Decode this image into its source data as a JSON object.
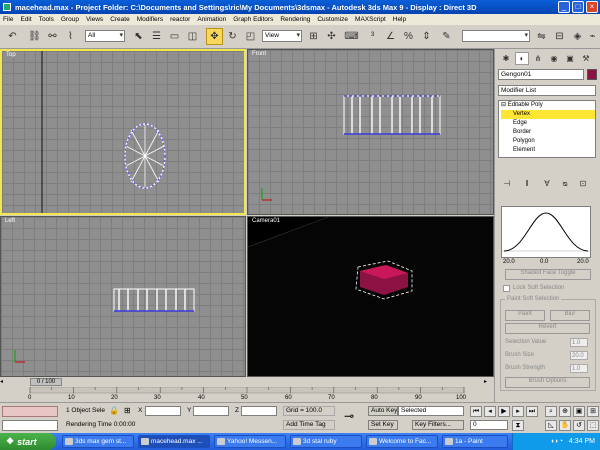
{
  "window": {
    "title": "macehead.max   - Project Folder: C:\\Documents and Settings\\ric\\My Documents\\3dsmax   - Autodesk 3ds Max 9   - Display : Direct 3D"
  },
  "menu": [
    "File",
    "Edit",
    "Tools",
    "Group",
    "Views",
    "Create",
    "Modifiers",
    "reactor",
    "Animation",
    "Graph Editors",
    "Rendering",
    "Customize",
    "MAXScript",
    "Help"
  ],
  "toolbar": {
    "selection_filter": "All",
    "coord_system": "View"
  },
  "viewports": {
    "top": "Top",
    "front": "Front",
    "left": "Left",
    "camera": "Camera01"
  },
  "command_panel": {
    "object_name": "Gengon01",
    "modifier_list": "Modifier List",
    "stack": [
      "Editable Poly",
      "Vertex",
      "Edge",
      "Border",
      "Polygon",
      "Element"
    ],
    "selected_subobject": "Vertex",
    "curve_labels": [
      "20.0",
      "0.0",
      "20.0"
    ],
    "shaded_face_toggle": "Shaded Face Toggle",
    "lock_soft_selection": "Lock Soft Selection",
    "paint_soft_selection": "Paint Soft Selection",
    "paint": "Paint",
    "blur": "Blur",
    "revert": "Revert",
    "selection_value_label": "Selection Value",
    "selection_value": "1.0",
    "brush_size_label": "Brush Size",
    "brush_size": "20.0",
    "brush_strength_label": "Brush Strength",
    "brush_strength": "1.0",
    "brush_options": "Brush Options"
  },
  "timeline": {
    "frame_display": "0 / 100",
    "ticks": [
      "0",
      "10",
      "20",
      "30",
      "40",
      "50",
      "60",
      "70",
      "80",
      "90",
      "100"
    ]
  },
  "status": {
    "selection_info": "1 Object Sele",
    "x_label": "X",
    "y_label": "Y",
    "z_label": "Z",
    "grid": "Grid = 100.0",
    "auto_key": "Auto Key",
    "key_mode": "Selected",
    "set_key": "Set Key",
    "key_filters": "Key Filters...",
    "rendering_time": "Rendering Time  0:00:00",
    "add_time_tag": "Add Time Tag",
    "current_frame": "0"
  },
  "taskbar": {
    "start": "start",
    "tasks": [
      "3ds max gem st...",
      "macehead.max ...",
      "Yahoo! Messen...",
      "3d stal ruby",
      "Welcome to Fac...",
      "1a - Paint"
    ],
    "active_task_index": 1,
    "clock": "4:34 PM"
  },
  "colors": {
    "viewport_grey": "#8f8f8f",
    "active_border": "#f2e64e",
    "vertex_highlight": "#fee634",
    "mesh_blue": "#3a3ae0",
    "object_magenta": "#c8185a"
  }
}
